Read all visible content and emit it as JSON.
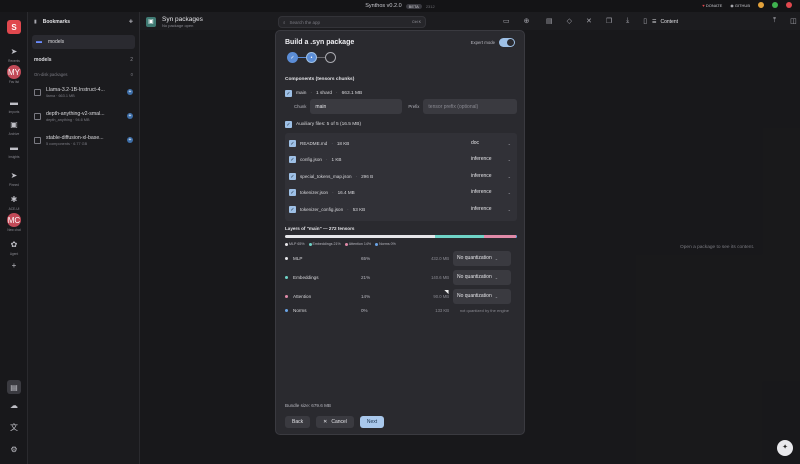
{
  "titlebar": {
    "app_title": "Synthos v0.2.0",
    "beta": "BETA",
    "ghost": "2312",
    "donate": "DONATE",
    "github": "GITHUB"
  },
  "colors": {
    "accent": "#9ec0e6",
    "primary_btn": "#a9c8ec",
    "logo": "#e0484e",
    "mlp": "#e6e6ea",
    "embeddings": "#6fd3c7",
    "attention": "#e08aa8",
    "norms": "#6aa4e6"
  },
  "rail": {
    "items": [
      {
        "icon": "logo-icon",
        "label": ""
      },
      {
        "icon": "pin-icon",
        "label": "Recents"
      },
      {
        "icon": "avatar",
        "label": "Fav list",
        "initials": "MY"
      },
      {
        "icon": "folder-icon",
        "label": "Imports"
      },
      {
        "icon": "box-icon",
        "label": "Archive"
      },
      {
        "icon": "folder-icon",
        "label": "Insights"
      },
      {
        "icon": "pin-icon",
        "label": "Pinned"
      },
      {
        "icon": "spark-icon",
        "label": "ACE-UI"
      },
      {
        "icon": "avatar",
        "label": "New chat",
        "initials": "MC"
      },
      {
        "icon": "brain-icon",
        "label": "Agent"
      },
      {
        "icon": "plus-icon",
        "label": ""
      }
    ],
    "bottom": [
      "database-icon",
      "cloud-download-icon",
      "translate-icon",
      "gear-icon"
    ]
  },
  "bookmarks": {
    "title": "Bookmarks",
    "folder": "models",
    "section": "models",
    "section_count": "2",
    "sub_label": "On-disk packages",
    "sub_count": "0",
    "items": [
      {
        "name": "Llama-3.2-1B-Instruct-4...",
        "meta": "llama · 663.1 MB"
      },
      {
        "name": "depth-anything-v2-smal...",
        "meta": "depth_anything · 94.6 MB"
      },
      {
        "name": "stable-diffusion-xl-base...",
        "meta": "5 components · 6.77 GB"
      }
    ]
  },
  "header": {
    "title": "Syn packages",
    "subtitle": "No package open",
    "search_placeholder": "Search the app",
    "search_kbd": "Ctrl K",
    "content_tab": "Content"
  },
  "empty_message": "Open a package to see its content.",
  "modal": {
    "title": "Build a .syn package",
    "expert_label": "Expert mode",
    "components_title": "Components (tensors chunks)",
    "main_row": {
      "name": "main",
      "shards": "1 shard",
      "size": "663.1 MB"
    },
    "chunk_label": "Chunk",
    "chunk_value": "main",
    "prefix_label": "Prefix",
    "prefix_placeholder": "tensor prefix (optional)",
    "aux_label": "Auxiliary files: 5 of 5 (16.5 MB)",
    "aux_files": [
      {
        "name": "README.md",
        "size": "18 KB",
        "type": "doc"
      },
      {
        "name": "config.json",
        "size": "1 KB",
        "type": "inference"
      },
      {
        "name": "special_tokens_map.json",
        "size": "296 B",
        "type": "inference"
      },
      {
        "name": "tokenizer.json",
        "size": "16.4 MB",
        "type": "inference"
      },
      {
        "name": "tokenizer_config.json",
        "size": "53 KB",
        "type": "inference"
      }
    ],
    "layers_title": "Layers of \"main\" — 272 tensors",
    "legend": [
      {
        "label": "MLP 65%"
      },
      {
        "label": "Embeddings 21%"
      },
      {
        "label": "Attention 14%"
      },
      {
        "label": "Norms 0%"
      }
    ],
    "layers": [
      {
        "name": "MLP",
        "pct": "65%",
        "size": "432.0 MB",
        "quant": "No quantization",
        "fraction": 0.65
      },
      {
        "name": "Embeddings",
        "pct": "21%",
        "size": "140.6 MB",
        "quant": "No quantization",
        "fraction": 0.21
      },
      {
        "name": "Attention",
        "pct": "14%",
        "size": "90.0 MB",
        "quant": "No quantization",
        "fraction": 0.14
      },
      {
        "name": "Norms",
        "pct": "0%",
        "size": "133 KB",
        "note": "not quantized by the engine",
        "fraction": 0.003
      }
    ],
    "bundle_size": "Bundle size: 679.6 MB",
    "back": "Back",
    "cancel": "Cancel",
    "next": "Next"
  }
}
